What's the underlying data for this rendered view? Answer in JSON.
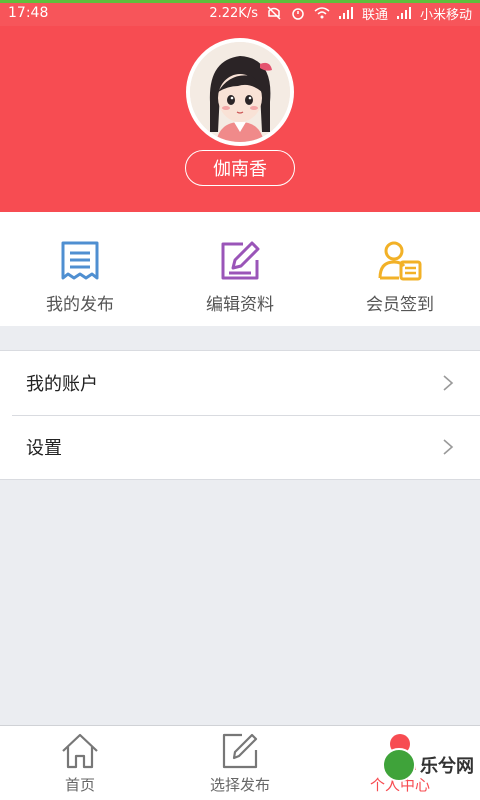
{
  "status_bar": {
    "time": "17:48",
    "speed": "2.22K/s",
    "carrier1": "联通",
    "carrier2": "小米移动"
  },
  "profile": {
    "username": "伽南香"
  },
  "quick_actions": [
    {
      "label": "我的发布",
      "icon": "receipt-icon",
      "color": "#4f8fd1"
    },
    {
      "label": "编辑资料",
      "icon": "edit-icon",
      "color": "#9a55b8"
    },
    {
      "label": "会员签到",
      "icon": "member-checkin-icon",
      "color": "#f2b127"
    }
  ],
  "menu": {
    "items": [
      {
        "label": "我的账户"
      },
      {
        "label": "设置"
      }
    ]
  },
  "tabbar": {
    "items": [
      {
        "label": "首页",
        "icon": "home-icon"
      },
      {
        "label": "选择发布",
        "icon": "edit-square-icon"
      },
      {
        "label": "个人中心",
        "icon": "person-icon"
      }
    ]
  },
  "watermark": {
    "text": "乐兮网"
  },
  "colors": {
    "brand_red": "#f74c52",
    "background": "#ebedf1"
  }
}
